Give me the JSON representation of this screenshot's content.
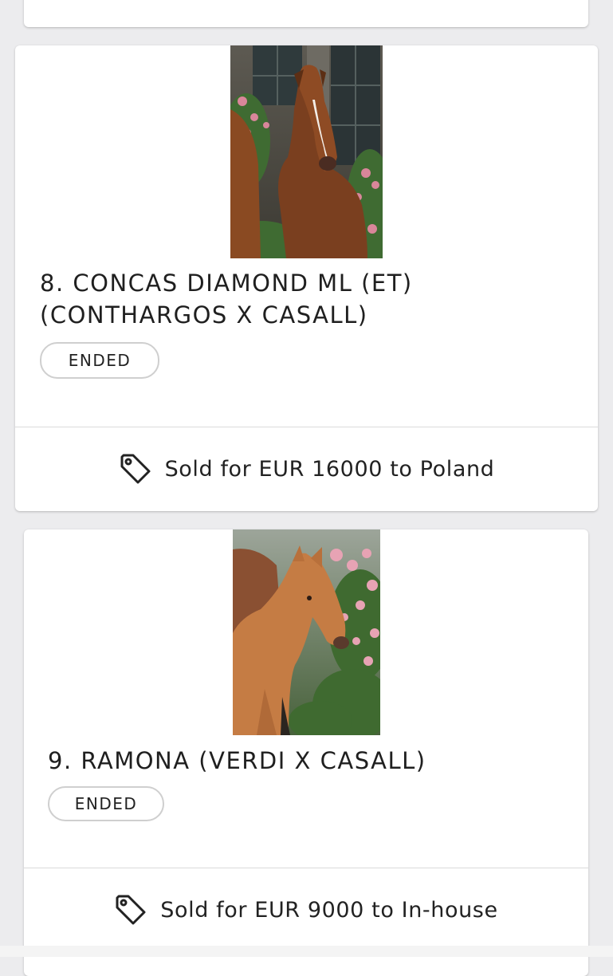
{
  "lots": [
    {
      "title": "8. CONCAS DIAMOND ML (ET) (CONTHARGOS X CASALL)",
      "status": "ENDED",
      "sold_text": "Sold for EUR 16000 to Poland",
      "icon": "price-tag-icon"
    },
    {
      "title": "9. RAMONA (VERDI X CASALL)",
      "status": "ENDED",
      "sold_text": "Sold for EUR 9000 to In-house",
      "icon": "price-tag-icon"
    }
  ],
  "colors": {
    "page_background": "#ececee",
    "card_background": "#ffffff",
    "text": "#1f1f1f",
    "badge_border": "#cfcfcf",
    "divider": "#dadada"
  }
}
